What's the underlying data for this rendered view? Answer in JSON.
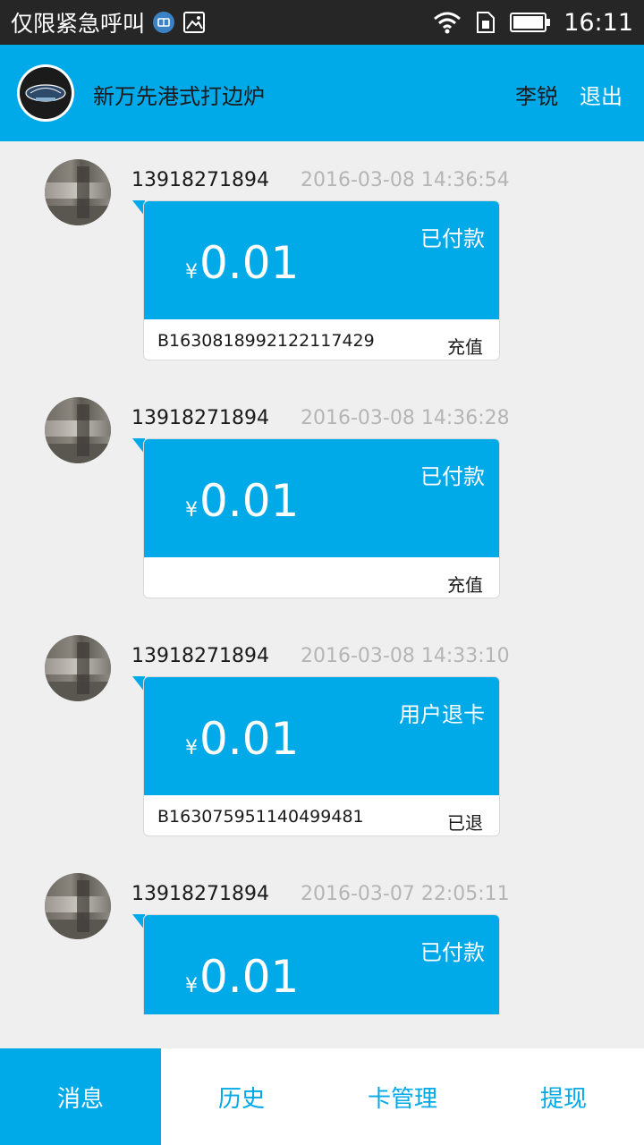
{
  "status_bar": {
    "carrier": "仅限紧急呼叫",
    "time": "16:11",
    "icons": [
      "network-badge-icon",
      "image-icon",
      "wifi-icon",
      "sim-icon",
      "battery-icon"
    ]
  },
  "header": {
    "store_name": "新万先港式打边炉",
    "user_name": "李锐",
    "logout_label": "退出"
  },
  "messages": [
    {
      "phone": "13918271894",
      "time": "2016-03-08 14:36:54",
      "status": "已付款",
      "currency": "¥",
      "amount": "0.01",
      "order_no": "B16308189921221174 29",
      "type": "充值"
    },
    {
      "phone": "13918271894",
      "time": "2016-03-08 14:36:28",
      "status": "已付款",
      "currency": "¥",
      "amount": "0.01",
      "order_no": "",
      "type": "充值"
    },
    {
      "phone": "13918271894",
      "time": "2016-03-08 14:33:10",
      "status": "用户退卡",
      "currency": "¥",
      "amount": "0.01",
      "order_no": "B163075951140499481",
      "type": "已退"
    },
    {
      "phone": "13918271894",
      "time": "2016-03-07 22:05:11",
      "status": "已付款",
      "currency": "¥",
      "amount": "0.01"
    }
  ],
  "bottom_nav": {
    "tabs": [
      "消息",
      "历史",
      "卡管理",
      "提现"
    ],
    "active": "消息"
  },
  "colors": {
    "accent": "#00a9e8",
    "status_bar": "#262626",
    "background": "#efefef"
  }
}
